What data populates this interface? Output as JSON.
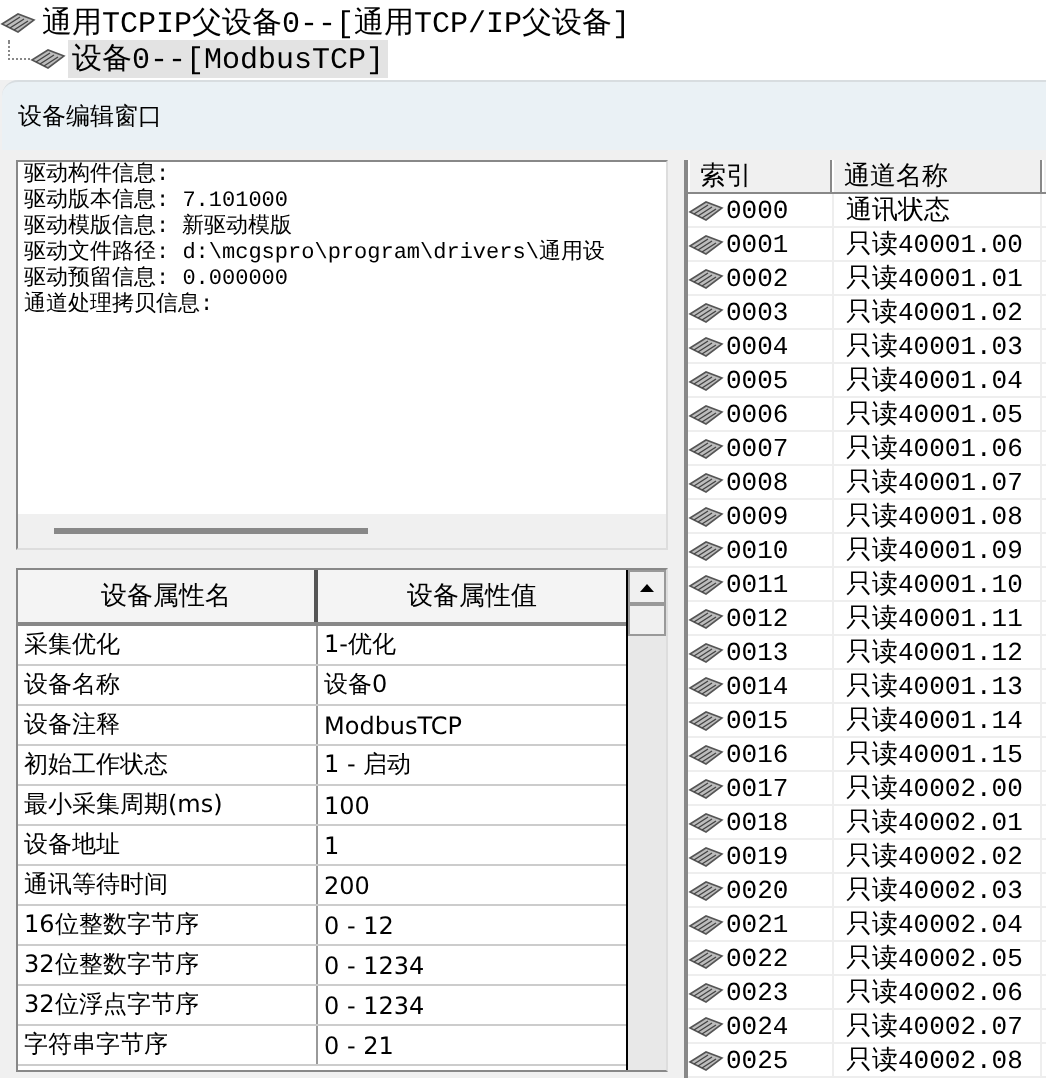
{
  "tree": [
    {
      "label": "通用TCPIP父设备0--[通用TCP/IP父设备]",
      "selected": false,
      "children": [
        {
          "label": "设备0--[ModbusTCP]",
          "selected": true
        }
      ]
    }
  ],
  "window": {
    "title": "设备编辑窗口"
  },
  "driver_info": {
    "lines": [
      "驱动构件信息:",
      "驱动版本信息: 7.101000",
      "驱动模版信息: 新驱动模版",
      "驱动文件路径: d:\\mcgspro\\program\\drivers\\通用设",
      "驱动预留信息: 0.000000",
      "通道处理拷贝信息:"
    ]
  },
  "property_table": {
    "columns": [
      "设备属性名",
      "设备属性值"
    ],
    "rows": [
      [
        "采集优化",
        "1-优化"
      ],
      [
        "设备名称",
        "设备0"
      ],
      [
        "设备注释",
        "ModbusTCP"
      ],
      [
        "初始工作状态",
        "1 - 启动"
      ],
      [
        "最小采集周期(ms)",
        "100"
      ],
      [
        "设备地址",
        "1"
      ],
      [
        "通讯等待时间",
        "200"
      ],
      [
        "16位整数字节序",
        "0 - 12"
      ],
      [
        "32位整数字节序",
        "0 - 1234"
      ],
      [
        "32位浮点字节序",
        "0 - 1234"
      ],
      [
        "字符串字节序",
        "0 - 21"
      ]
    ]
  },
  "channel_table": {
    "columns": [
      "索引",
      "通道名称"
    ],
    "rows": [
      {
        "index": "0000",
        "name": "通讯状态"
      },
      {
        "index": "0001",
        "name": "只读40001.00"
      },
      {
        "index": "0002",
        "name": "只读40001.01"
      },
      {
        "index": "0003",
        "name": "只读40001.02"
      },
      {
        "index": "0004",
        "name": "只读40001.03"
      },
      {
        "index": "0005",
        "name": "只读40001.04"
      },
      {
        "index": "0006",
        "name": "只读40001.05"
      },
      {
        "index": "0007",
        "name": "只读40001.06"
      },
      {
        "index": "0008",
        "name": "只读40001.07"
      },
      {
        "index": "0009",
        "name": "只读40001.08"
      },
      {
        "index": "0010",
        "name": "只读40001.09"
      },
      {
        "index": "0011",
        "name": "只读40001.10"
      },
      {
        "index": "0012",
        "name": "只读40001.11"
      },
      {
        "index": "0013",
        "name": "只读40001.12"
      },
      {
        "index": "0014",
        "name": "只读40001.13"
      },
      {
        "index": "0015",
        "name": "只读40001.14"
      },
      {
        "index": "0016",
        "name": "只读40001.15"
      },
      {
        "index": "0017",
        "name": "只读40002.00"
      },
      {
        "index": "0018",
        "name": "只读40002.01"
      },
      {
        "index": "0019",
        "name": "只读40002.02"
      },
      {
        "index": "0020",
        "name": "只读40002.03"
      },
      {
        "index": "0021",
        "name": "只读40002.04"
      },
      {
        "index": "0022",
        "name": "只读40002.05"
      },
      {
        "index": "0023",
        "name": "只读40002.06"
      },
      {
        "index": "0024",
        "name": "只读40002.07"
      },
      {
        "index": "0025",
        "name": "只读40002.08"
      }
    ]
  }
}
